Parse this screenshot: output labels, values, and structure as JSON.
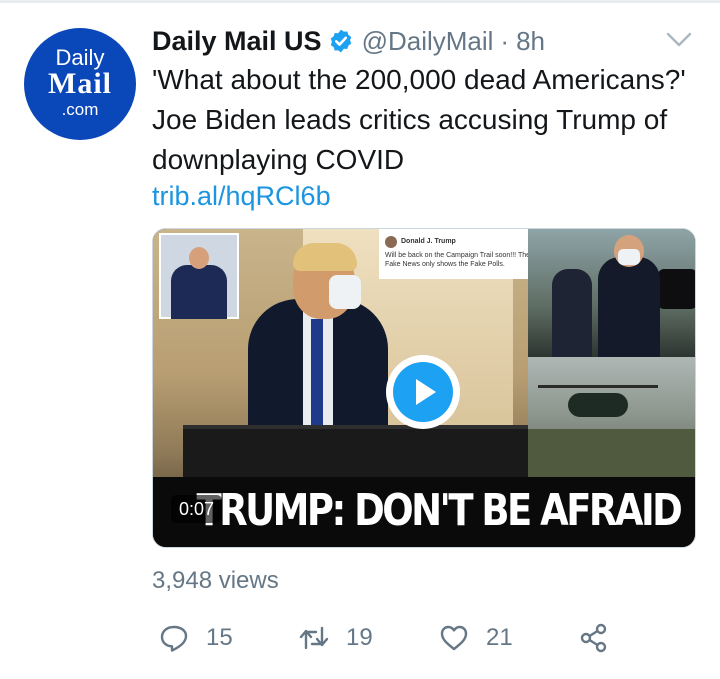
{
  "account": {
    "avatar_line1": "Daily",
    "avatar_line2": "Mail",
    "avatar_line3": ".com",
    "display_name": "Daily Mail US",
    "handle": "@DailyMail",
    "separator": "·",
    "time": "8h",
    "verified": true,
    "verified_icon": "verified-badge-icon"
  },
  "tweet": {
    "text": "'What about the 200,000 dead Americans?' Joe Biden leads critics accusing Trump of downplaying COVID",
    "link": "trib.al/hqRCl6b"
  },
  "media": {
    "type": "video",
    "overlay_headline": "TRUMP: DON'T BE AFRAID",
    "duration": "0:07",
    "embedded_tweet_author": "Donald J. Trump",
    "embedded_tweet_text": "Will be back on the Campaign Trail soon!!! The Fake News only shows the Fake Polls."
  },
  "stats": {
    "views": "3,948 views",
    "replies": "15",
    "retweets": "19",
    "likes": "21"
  },
  "colors": {
    "accent": "#1da1f2",
    "link": "#1b95e0",
    "muted": "#657786",
    "brand_blue": "#0a47b8"
  }
}
